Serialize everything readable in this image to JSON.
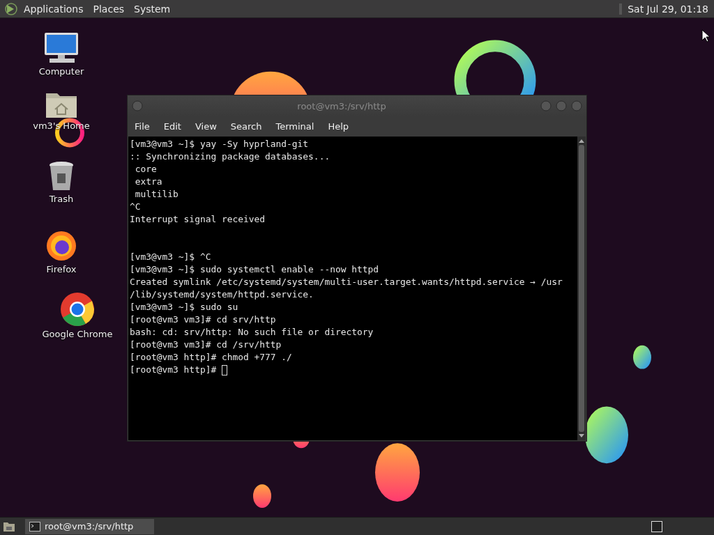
{
  "top_panel": {
    "menus": [
      "Applications",
      "Places",
      "System"
    ],
    "clock": "Sat Jul 29, 01:18"
  },
  "desktop_icons": [
    {
      "label": "Computer",
      "kind": "computer"
    },
    {
      "label": "vm3's Home",
      "kind": "home"
    },
    {
      "label": "Trash",
      "kind": "trash"
    },
    {
      "label": "Firefox",
      "kind": "firefox"
    },
    {
      "label": "Google Chrome",
      "kind": "chrome"
    }
  ],
  "terminal_window": {
    "title": "root@vm3:/srv/http",
    "menu": [
      "File",
      "Edit",
      "View",
      "Search",
      "Terminal",
      "Help"
    ],
    "lines": [
      {
        "text": "[vm3@vm3 ~]$ yay -Sy hyprland-git",
        "blank_before": false,
        "cursor": false
      },
      {
        "text": ":: Synchronizing package databases...",
        "blank_before": false,
        "cursor": false
      },
      {
        "text": " core",
        "blank_before": false,
        "cursor": false
      },
      {
        "text": " extra",
        "blank_before": false,
        "cursor": false
      },
      {
        "text": " multilib",
        "blank_before": false,
        "cursor": false
      },
      {
        "text": "^C",
        "blank_before": false,
        "cursor": false
      },
      {
        "text": "Interrupt signal received",
        "blank_before": false,
        "cursor": false
      },
      {
        "text": "[vm3@vm3 ~]$ ^C",
        "blank_before": true,
        "cursor": false
      },
      {
        "text": "[vm3@vm3 ~]$ sudo systemctl enable --now httpd",
        "blank_before": false,
        "cursor": false
      },
      {
        "text": "Created symlink /etc/systemd/system/multi-user.target.wants/httpd.service → /usr",
        "blank_before": false,
        "cursor": false
      },
      {
        "text": "/lib/systemd/system/httpd.service.",
        "blank_before": false,
        "cursor": false
      },
      {
        "text": "[vm3@vm3 ~]$ sudo su",
        "blank_before": false,
        "cursor": false
      },
      {
        "text": "[root@vm3 vm3]# cd srv/http",
        "blank_before": false,
        "cursor": false
      },
      {
        "text": "bash: cd: srv/http: No such file or directory",
        "blank_before": false,
        "cursor": false
      },
      {
        "text": "[root@vm3 vm3]# cd /srv/http",
        "blank_before": false,
        "cursor": false
      },
      {
        "text": "[root@vm3 http]# chmod +777 ./",
        "blank_before": false,
        "cursor": false
      },
      {
        "text": "[root@vm3 http]# ",
        "blank_before": false,
        "cursor": true
      }
    ]
  },
  "taskbar": {
    "tasks": [
      {
        "label": "root@vm3:/srv/http",
        "selected": true
      }
    ]
  }
}
